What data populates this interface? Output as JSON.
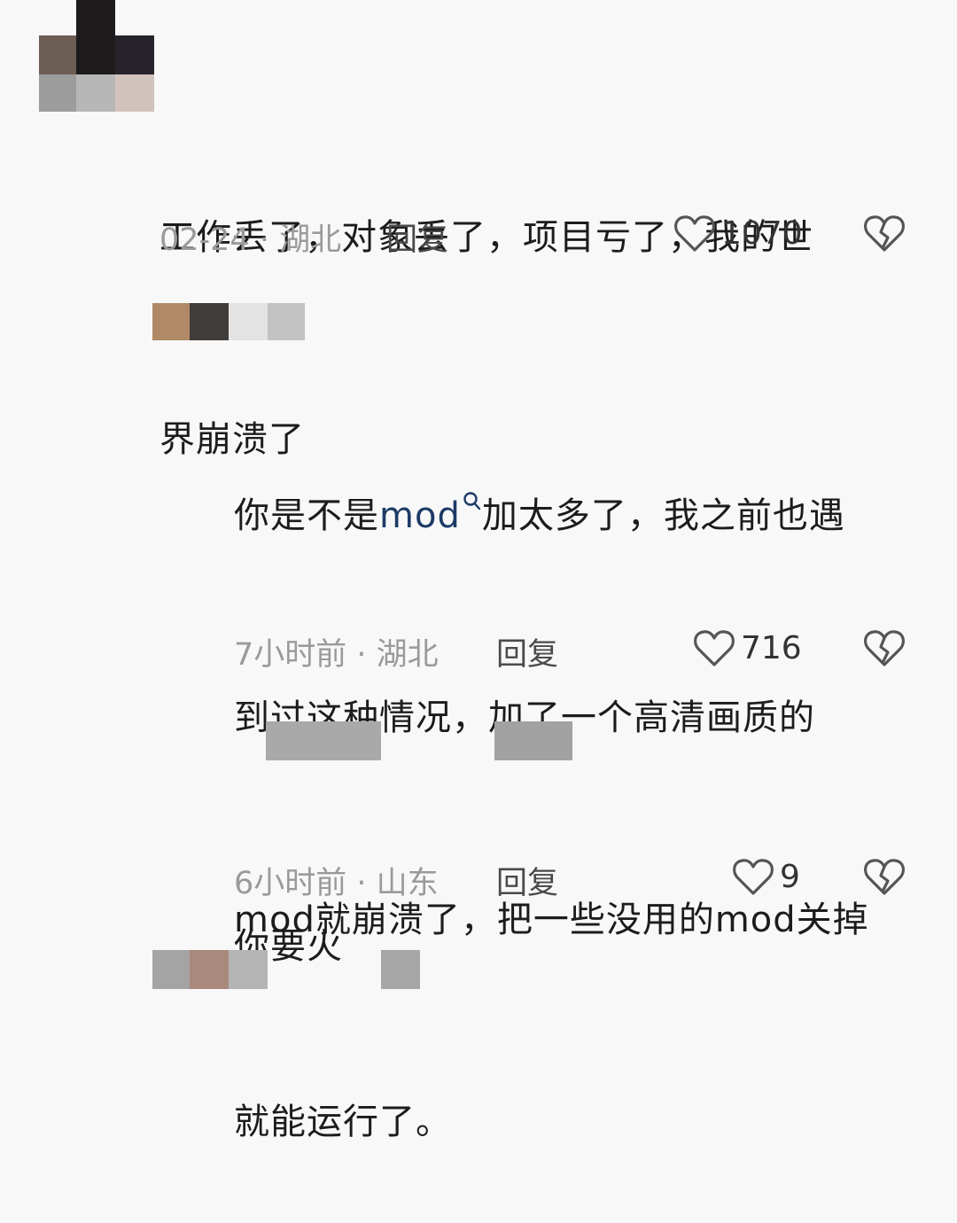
{
  "comments": [
    {
      "line1": "工作丢了，对象丢了，项目亏了，我的世",
      "line2": "界崩溃了",
      "meta": "02-24 · 湖北",
      "reply_label": "回复",
      "likes": "1070"
    },
    {
      "prefix": "你是不是",
      "keyword": "mod",
      "line1_rest": "加太多了，我之前也遇",
      "line2": "到过这种情况，加了一个高清画质的",
      "line3": "mod就崩溃了，把一些没用的mod关掉",
      "line4": "就能运行了。",
      "meta": "7小时前 · 湖北",
      "reply_label": "回复",
      "likes": "716"
    },
    {
      "text": "你要火",
      "meta": "6小时前 · 山东",
      "reply_label": "回复",
      "likes": "9"
    }
  ],
  "colors": {
    "background": "#f8f8f8",
    "keyword": "#1c3a66",
    "meta": "#9a9a9a",
    "pixelated_username": "#a5a5a5"
  },
  "icons": [
    "heart-outline-icon",
    "broken-heart-icon",
    "search-icon"
  ]
}
